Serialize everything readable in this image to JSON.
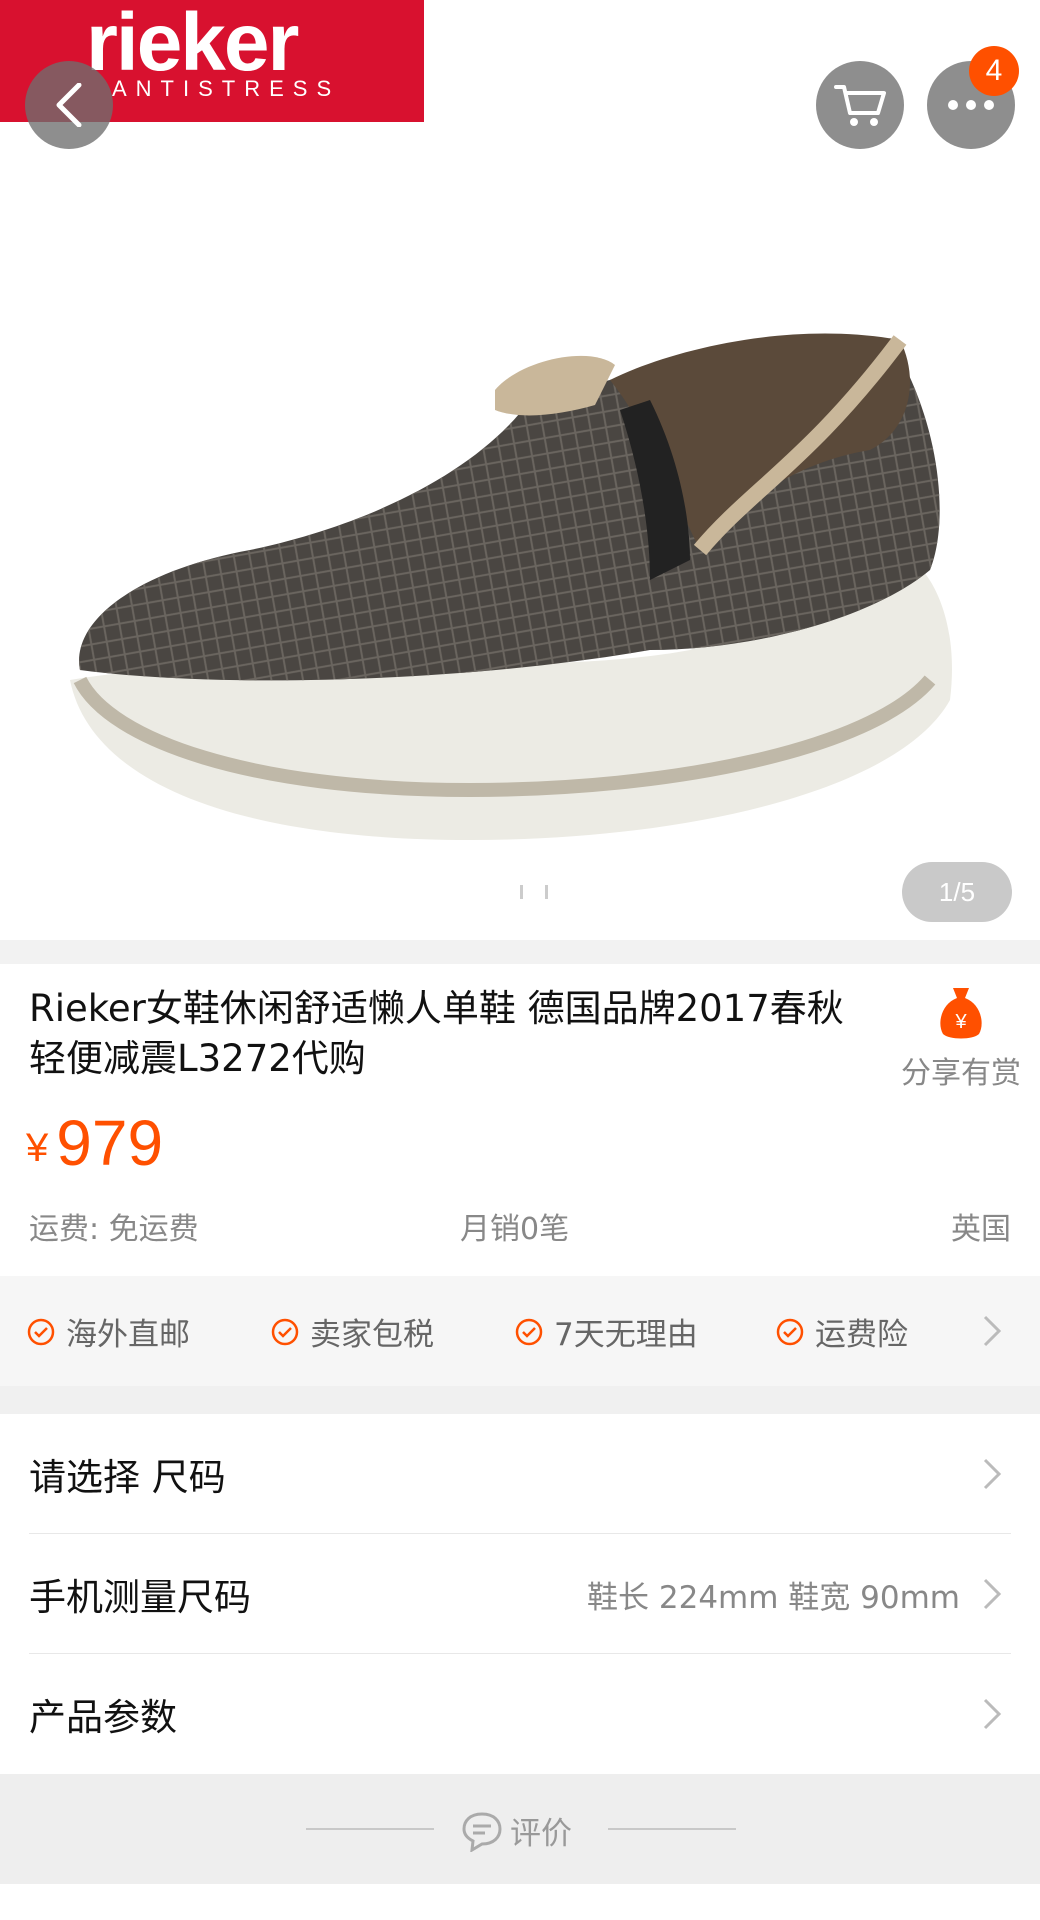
{
  "hero": {
    "brand": {
      "name": "rieker",
      "tagline": "ANTISTRESS"
    },
    "cart_badge_count": "4",
    "pager": "1/5"
  },
  "product": {
    "title": "Rieker女鞋休闲舒适懒人单鞋 德国品牌2017春秋轻便减震L3272代购",
    "share_label": "分享有赏",
    "price_currency": "¥",
    "price": "979",
    "shipping": "运费: 免运费",
    "monthly_sales": "月销0笔",
    "origin": "英国"
  },
  "services": [
    "海外直邮",
    "卖家包税",
    "7天无理由",
    "运费险"
  ],
  "rows": [
    {
      "label": "请选择 尺码",
      "value": ""
    },
    {
      "label": "手机测量尺码",
      "value": "鞋长 224mm 鞋宽 90mm"
    },
    {
      "label": "产品参数",
      "value": ""
    }
  ],
  "review_label": "评价",
  "colors": {
    "accent": "#ff5000",
    "brand_red": "#d8112f"
  },
  "icons": [
    "back-icon",
    "cart-icon",
    "more-icon",
    "share-bag-icon",
    "check-circle-icon",
    "chevron-right-icon",
    "comment-icon"
  ]
}
